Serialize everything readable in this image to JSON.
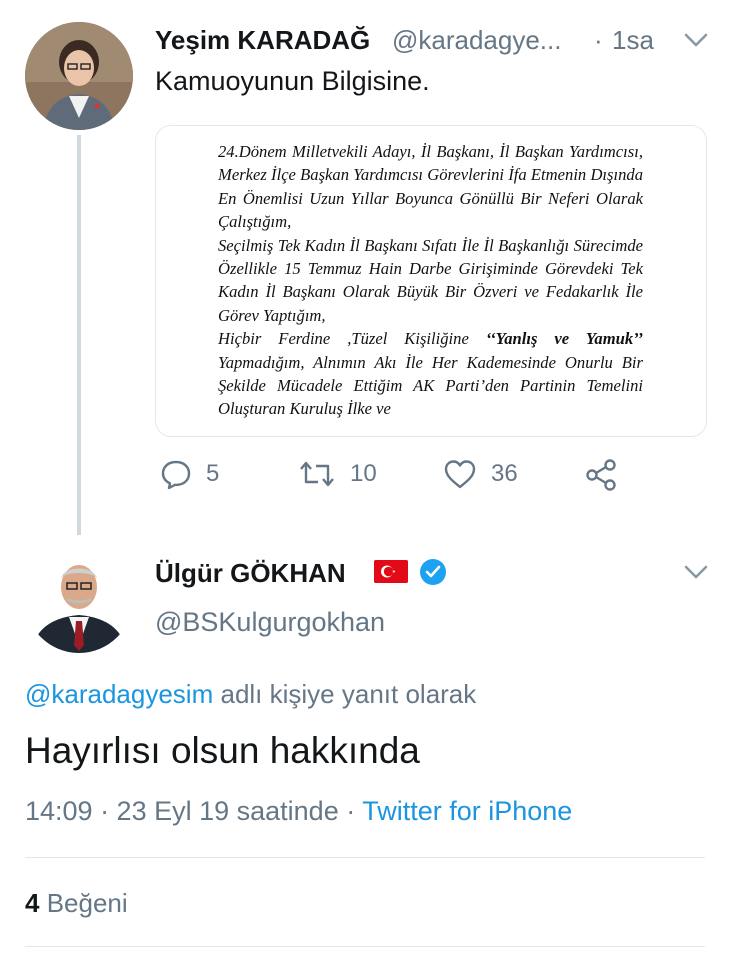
{
  "first_tweet": {
    "display_name": "Yeşim KARADAĞ",
    "handle": "@karadagye...",
    "separator": "·",
    "time": "1sa",
    "text": "Kamuoyunun Bilgisine.",
    "document_lines": [
      "24.Dönem Milletvekili Adayı, İl Başkanı, İl Başkan Yardımcısı, Merkez İlçe Başkan Yardımcısı Görevlerini İfa Etmenin Dışında En Önemlisi Uzun Yıllar Boyunca Gönüllü Bir Neferi Olarak Çalıştığım,",
      "Seçilmiş Tek Kadın İl Başkanı Sıfatı İle İl Başkanlığı Sürecimde Özellikle 15 Temmuz Hain Darbe Girişiminde Görevdeki Tek Kadın İl Başkanı Olarak Büyük Bir Özveri ve Fedakarlık İle Görev Yaptığım,",
      "Hiçbir Ferdine ,Tüzel Kişiliğine ",
      "‘‘Yanlış ve Yamuk’’",
      " Yapmadığım, Alnımın Akı İle Her Kademesinde Onurlu Bir Şekilde Mücadele Ettiğim AK Parti’den Partinin Temelini Oluşturan Kuruluş İlke ve"
    ],
    "replies": "5",
    "retweets": "10",
    "likes": "36",
    "icons": [
      "reply-icon",
      "retweet-icon",
      "heart-icon",
      "share-icon"
    ]
  },
  "reply_tweet": {
    "display_name": "Ülgür GÖKHAN",
    "handle": "@BSKulgurgokhan",
    "reply_to_handle": "@karadagyesim",
    "reply_to_suffix": "adlı kişiye yanıt olarak",
    "text": "Hayırlısı olsun hakkında",
    "timestamp": "14:09 · 23 Eyl 19 saatinde · ",
    "source": "Twitter for iPhone",
    "likes_count": "4",
    "likes_label": "Beğeni",
    "icons": [
      "turkey-flag-icon",
      "verified-badge-icon",
      "chevron-down-icon"
    ]
  },
  "colors": {
    "link": "#1b95e0",
    "muted": "#657786",
    "verified": "#1da1f2",
    "flag": "#e30a17",
    "thread_line": "#cfd9de"
  }
}
